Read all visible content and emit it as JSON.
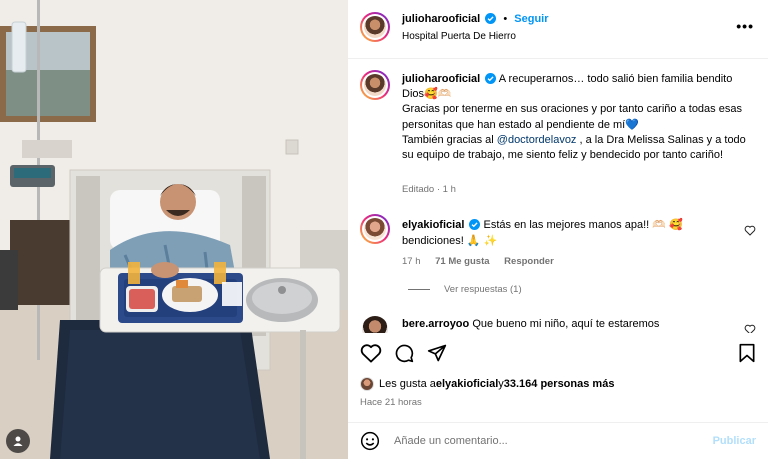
{
  "post_header": {
    "username": "julioharooficial",
    "follow_label": "Seguir",
    "location": "Hospital Puerta De Hierro",
    "more_icon": "more-horizontal-icon"
  },
  "caption": {
    "username": "julioharooficial",
    "line1": "A recuperarnos… todo salió bien familia bendito Dios🥰🫶🏻",
    "line2": "Gracias por tenerme en sus oraciones y por tanto cariño a todas esas personitas que han estado al pendiente de mí",
    "line2_heart": "💙",
    "line3_before": "También gracias al ",
    "mention": "@doctordelavoz",
    "line3_after": " , a la Dra Melissa Salinas y a todo su equipo de trabajo, me siento feliz y bendecido por tanto cariño!",
    "meta": "Editado · 1 h"
  },
  "comments": [
    {
      "username": "elyakioficial",
      "text": "Estás en las mejores manos apa!! 🫶🏻 🥰 bendiciones! 🙏 ✨",
      "time": "17 h",
      "likes": "71 Me gusta",
      "reply_label": "Responder",
      "view_replies": "Ver respuestas (1)"
    },
    {
      "username": "bere.arroyoo",
      "text": "Que bueno mi niño, aquí te estaremos"
    }
  ],
  "likes_line": {
    "prefix": "Les gusta a ",
    "user": "elyakioficial",
    "middle": " y ",
    "count": "33.164 personas más"
  },
  "posted_time": "Hace 21 horas",
  "comment_input": {
    "placeholder": "Añade un comentario...",
    "publish_label": "Publicar"
  },
  "colors": {
    "accent": "#0095f6",
    "mention": "#00376b",
    "muted": "#737373",
    "publish_disabled": "#b2dffc"
  }
}
